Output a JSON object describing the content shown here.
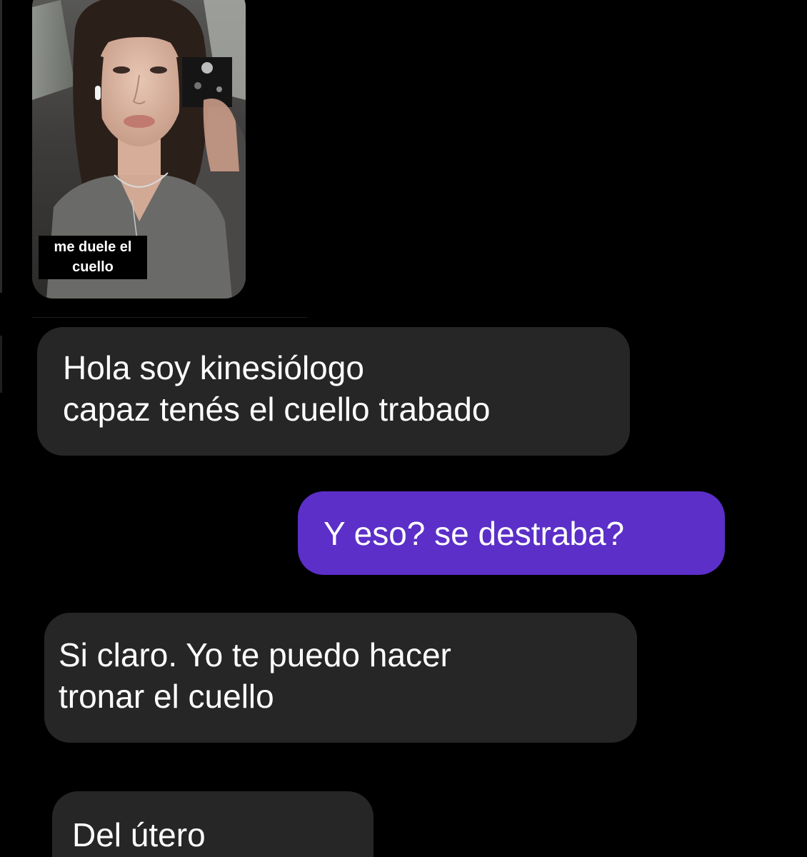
{
  "story_reply": {
    "caption": "me duele el cuello"
  },
  "messages": [
    {
      "direction": "received",
      "lines": [
        "Hola soy kinesiólogo",
        "capaz tenés el cuello trabado"
      ]
    },
    {
      "direction": "sent",
      "lines": [
        "Y eso? se destraba?"
      ]
    },
    {
      "direction": "received",
      "lines": [
        "Si claro. Yo te puedo hacer",
        "tronar el cuello"
      ]
    },
    {
      "direction": "received",
      "lines": [
        "Del útero"
      ]
    }
  ],
  "colors": {
    "background": "#000000",
    "received_bubble": "#262626",
    "sent_bubble": "#5b2fc8",
    "text": "#ffffff"
  }
}
